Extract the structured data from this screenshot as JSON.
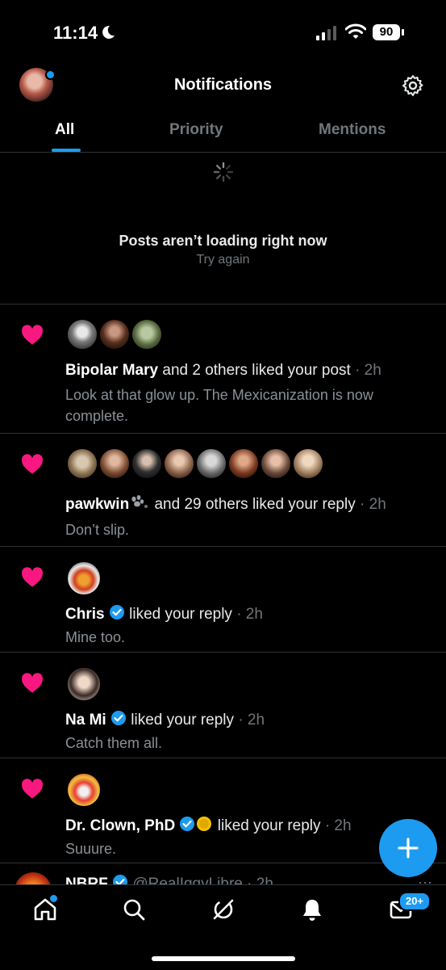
{
  "status": {
    "time": "11:14",
    "battery": "90"
  },
  "header": {
    "title": "Notifications"
  },
  "tabs": [
    {
      "label": "All"
    },
    {
      "label": "Priority"
    },
    {
      "label": "Mentions"
    }
  ],
  "loading": {
    "message": "Posts aren’t loading right now",
    "retry": "Try again"
  },
  "notifications": [
    {
      "name": "Bipolar Mary",
      "action": "and 2 others liked your post",
      "time": "· 2h",
      "text": "Look at that glow up. The Mexicanization is now complete."
    },
    {
      "name": "pawkwin",
      "action": "and 29 others liked your reply",
      "time": "· 2h",
      "text": "Don’t slip."
    },
    {
      "name": "Chris",
      "action": "liked your reply",
      "time": "· 2h",
      "text": "Mine too."
    },
    {
      "name": "Na Mi",
      "action": "liked your reply",
      "time": "· 2h",
      "text": "Catch them all."
    },
    {
      "name": "Dr. Clown, PhD",
      "action": "liked your reply",
      "time": "· 2h",
      "text": "Suuure."
    }
  ],
  "partial_post": {
    "name": "NBRF",
    "handle": "@RealIggyLibre · 2h"
  },
  "bottom_nav": {
    "messages_badge": "20+"
  },
  "colors": {
    "accent": "#1d9bf0",
    "like": "#f91880",
    "background": "#000000",
    "muted": "#71767b"
  },
  "icons": [
    "moon-icon",
    "signal-icon",
    "wifi-icon",
    "battery-icon",
    "gear-icon",
    "spinner-icon",
    "heart-icon",
    "verified-icon",
    "paw-icon",
    "plus-icon",
    "home-icon",
    "search-icon",
    "grok-icon",
    "bell-icon",
    "mail-icon"
  ]
}
